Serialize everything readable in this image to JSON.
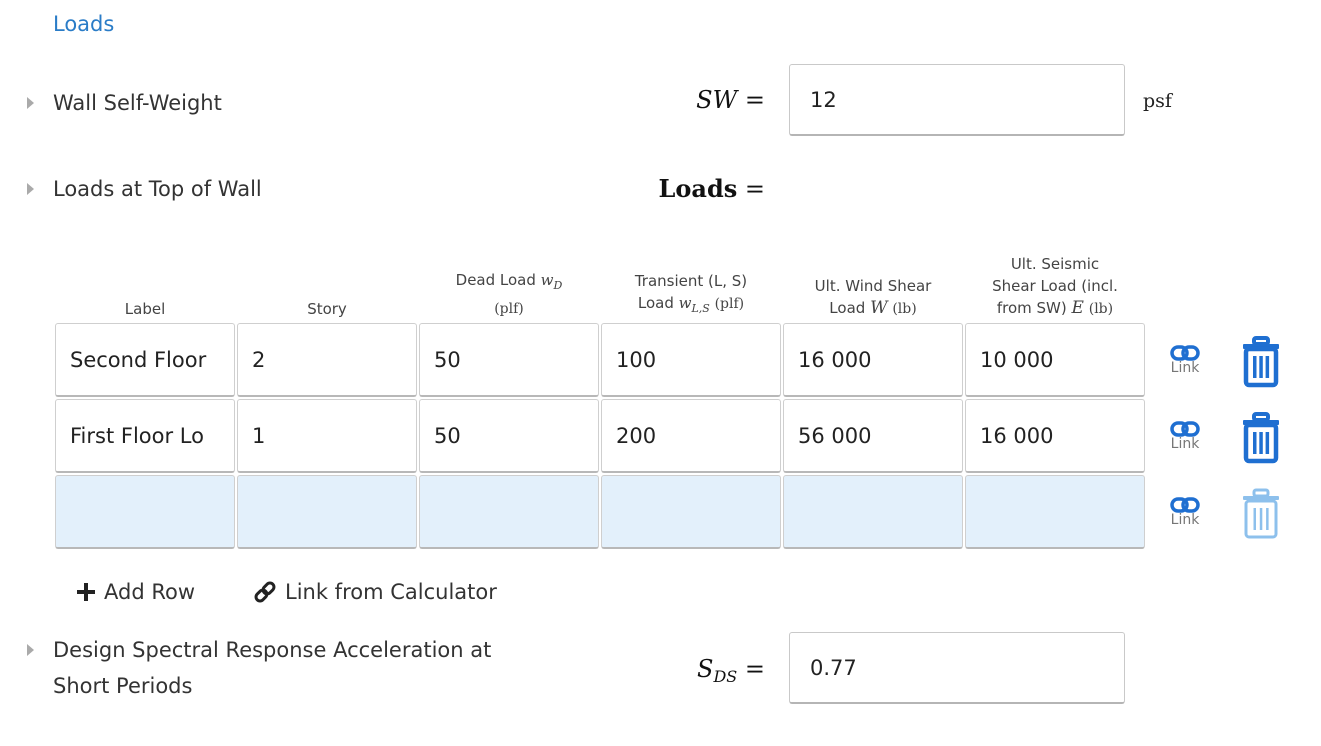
{
  "section": {
    "title": "Loads"
  },
  "self_weight": {
    "label": "Wall Self-Weight",
    "var": "SW",
    "equals": "=",
    "value": "12",
    "unit": "psf"
  },
  "top_loads": {
    "label": "Loads at Top of Wall",
    "var": "Loads",
    "equals": "="
  },
  "table": {
    "headers": {
      "label": "Label",
      "story": "Story",
      "dead_text": "Dead Load",
      "dead_sym": "w",
      "dead_sub": "D",
      "dead_unit": "(plf)",
      "transient_line1": "Transient (L, S)",
      "transient_text": "Load",
      "transient_sym": "w",
      "transient_sub": "L,S",
      "transient_unit": "(plf)",
      "wind_line1": "Ult. Wind Shear",
      "wind_text": "Load",
      "wind_sym": "W",
      "wind_unit": "(lb)",
      "seismic_line1": "Ult. Seismic",
      "seismic_line2": "Shear Load (incl.",
      "seismic_text": "from SW)",
      "seismic_sym": "E",
      "seismic_unit": "(lb)"
    },
    "rows": [
      {
        "label": "Second Floor",
        "story": "2",
        "dead": "50",
        "transient": "100",
        "wind": "16 000",
        "seismic": "10 000",
        "link": "Link"
      },
      {
        "label": "First Floor Lo",
        "story": "1",
        "dead": "50",
        "transient": "200",
        "wind": "56 000",
        "seismic": "16 000",
        "link": "Link"
      },
      {
        "label": "",
        "story": "",
        "dead": "",
        "transient": "",
        "wind": "",
        "seismic": "",
        "link": "Link"
      }
    ]
  },
  "actions": {
    "add_row": "Add Row",
    "link_calc": "Link from Calculator"
  },
  "sds": {
    "label_line1": "Design Spectral Response Acceleration at",
    "label_line2": "Short Periods",
    "var": "S",
    "var_sub": "DS",
    "equals": "=",
    "value": "0.77"
  },
  "colors": {
    "accent": "#2a7cc7",
    "icon_blue": "#1f6fd1",
    "icon_disabled": "#8dc0ec",
    "empty_row": "#e3f0fb"
  },
  "icons": [
    "caret-right-icon",
    "link-icon",
    "trash-icon",
    "plus-icon",
    "chain-link-icon"
  ]
}
